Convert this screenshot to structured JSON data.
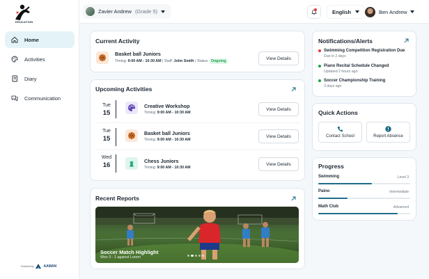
{
  "brand": {
    "logo_text": "EDUCATION",
    "powered_by": "Powered by",
    "powered_brand": "AAMAN"
  },
  "sidebar": {
    "items": [
      {
        "label": "Home",
        "icon": "home-icon",
        "active": true
      },
      {
        "label": "Activities",
        "icon": "palette-icon",
        "active": false
      },
      {
        "label": "Diary",
        "icon": "diary-icon",
        "active": false
      },
      {
        "label": "Communication",
        "icon": "chat-icon",
        "active": false
      }
    ]
  },
  "header": {
    "student_name": "Zavier Andrew",
    "student_grade": "(Grade 5)",
    "language": "English",
    "user_name": "Ben Andrew"
  },
  "current_activity": {
    "title": "Current Activity",
    "name": "Basket ball Juniors",
    "timing_label": "Timing:",
    "timing": "9:00 AM - 10:30 AM",
    "staff_label": "Staff:",
    "staff": "John Smith",
    "status_label": "Status:",
    "status": "Ongoing",
    "button": "View Details"
  },
  "upcoming": {
    "title": "Upcoming Activities",
    "items": [
      {
        "day": "Tue",
        "date": "15",
        "name": "Creative Workshop",
        "timing_label": "Timing:",
        "timing": "9:00 AM - 10:30 AM",
        "button": "View Details",
        "icon": "palette-icon"
      },
      {
        "day": "Tue",
        "date": "15",
        "name": "Basket ball Juniors",
        "timing_label": "Timing:",
        "timing": "9:00 AM - 10:30 AM",
        "button": "View Details",
        "icon": "basketball-icon"
      },
      {
        "day": "Wed",
        "date": "16",
        "name": "Chess Juniors",
        "timing_label": "Timing:",
        "timing": "9:00 AM - 10:30 AM",
        "button": "View Details",
        "icon": "chess-icon"
      }
    ]
  },
  "reports": {
    "title": "Recent Reports",
    "caption": "Soccer Match Highlight",
    "subcaption": "Won 3 - 1 against Lorem"
  },
  "notifications": {
    "title": "Notifications/Alerts",
    "items": [
      {
        "title": "Swimming Competition Registration Due",
        "sub": "Due in 2 days",
        "color": "#e53935"
      },
      {
        "title": "Piano Recital Schedule Changed",
        "sub": "Updated 2 hours ago",
        "color": "#16a34a"
      },
      {
        "title": "Soccer Championship Training",
        "sub": "3 days ago",
        "color": "#16a34a"
      }
    ]
  },
  "quick_actions": {
    "title": "Quick Actions",
    "items": [
      {
        "label": "Contact School",
        "icon": "phone-icon"
      },
      {
        "label": "Report Absence",
        "icon": "alert-icon"
      }
    ]
  },
  "progress": {
    "title": "Progress",
    "items": [
      {
        "label": "Swimming",
        "level": "Level 3",
        "fraction": 0.58
      },
      {
        "label": "Paino",
        "level": "Intermediate",
        "fraction": 0.32
      },
      {
        "label": "Math Club",
        "level": "Advanced",
        "fraction": 0.86
      }
    ]
  },
  "colors": {
    "accent": "#1e6c87",
    "active_nav": "#e4f3f8",
    "ongoing": "#15a34a"
  }
}
